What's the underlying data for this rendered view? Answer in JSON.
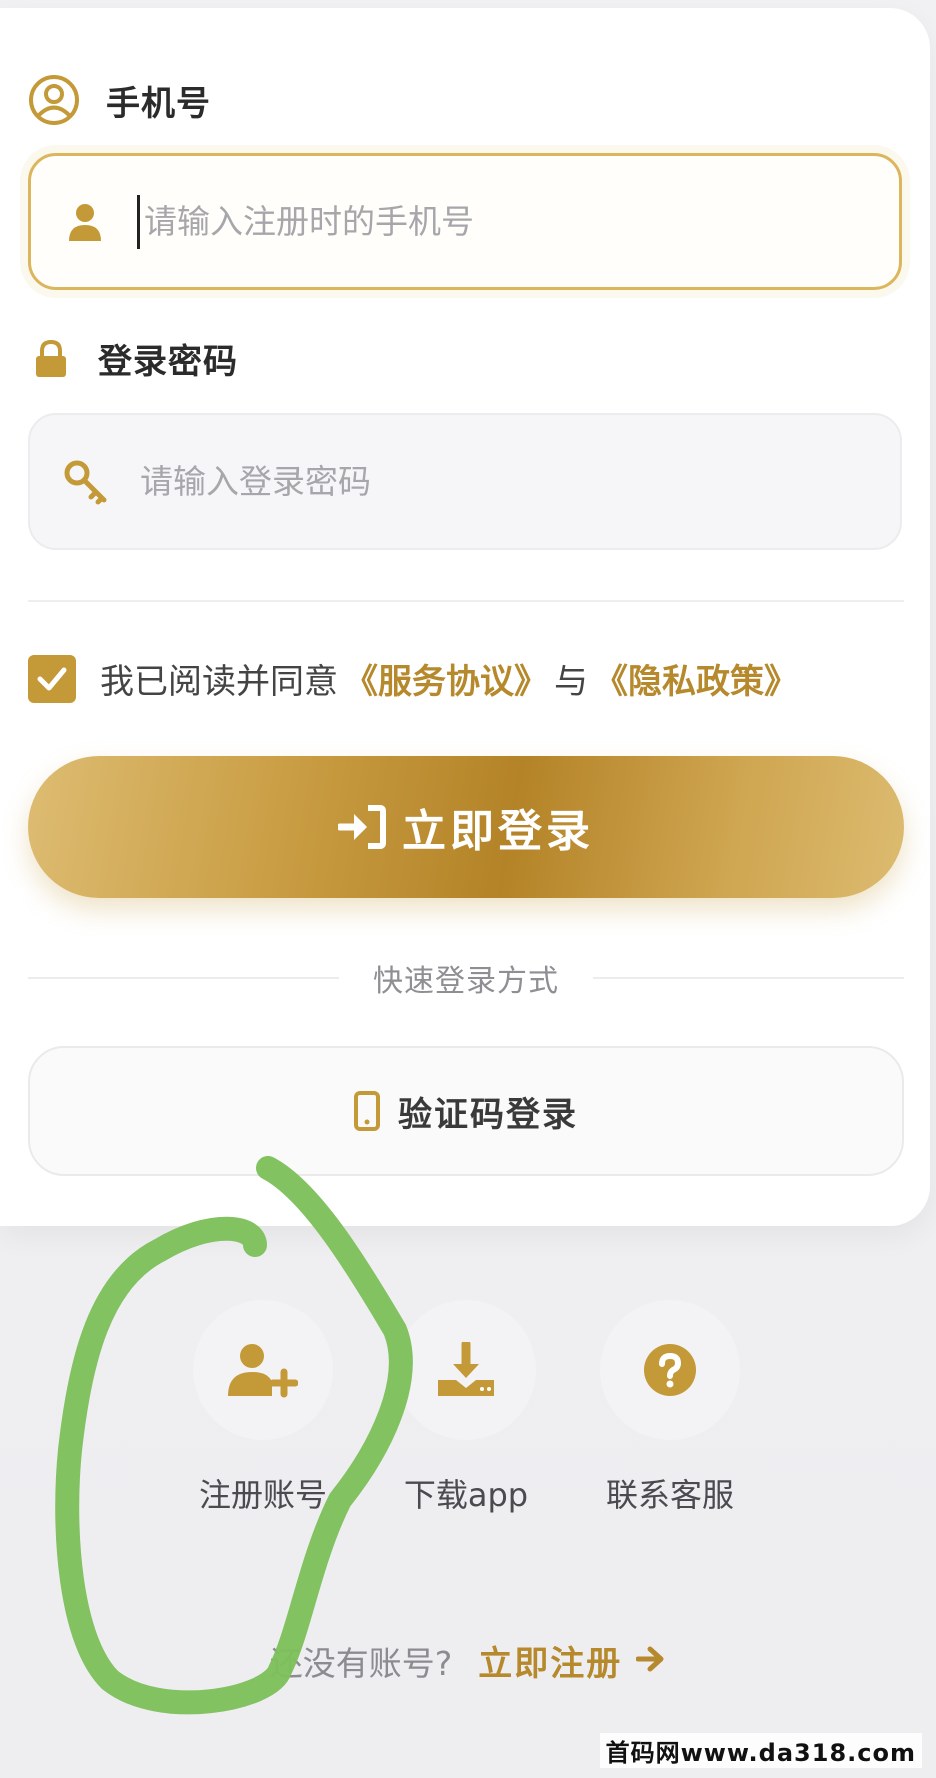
{
  "phone": {
    "label": "手机号",
    "placeholder": "请输入注册时的手机号",
    "value": ""
  },
  "password": {
    "label": "登录密码",
    "placeholder": "请输入登录密码",
    "value": ""
  },
  "agreement": {
    "checked": true,
    "prefix": "我已阅读并同意",
    "service_link": "《服务协议》",
    "conjunction": "与",
    "privacy_link": "《隐私政策》"
  },
  "login_button": {
    "label": "立即登录"
  },
  "quick_login": {
    "divider_text": "快速登录方式",
    "sms_button": "验证码登录"
  },
  "actions": [
    {
      "label": "注册账号",
      "icon": "user-plus-icon"
    },
    {
      "label": "下载app",
      "icon": "download-icon"
    },
    {
      "label": "联系客服",
      "icon": "question-circle-icon"
    }
  ],
  "signup": {
    "question": "还没有账号?",
    "link": "立即注册"
  },
  "watermark": "首码网www.da318.com",
  "colors": {
    "accent": "#c49a38",
    "link": "#b5892c",
    "annotation": "#7ec05c"
  }
}
